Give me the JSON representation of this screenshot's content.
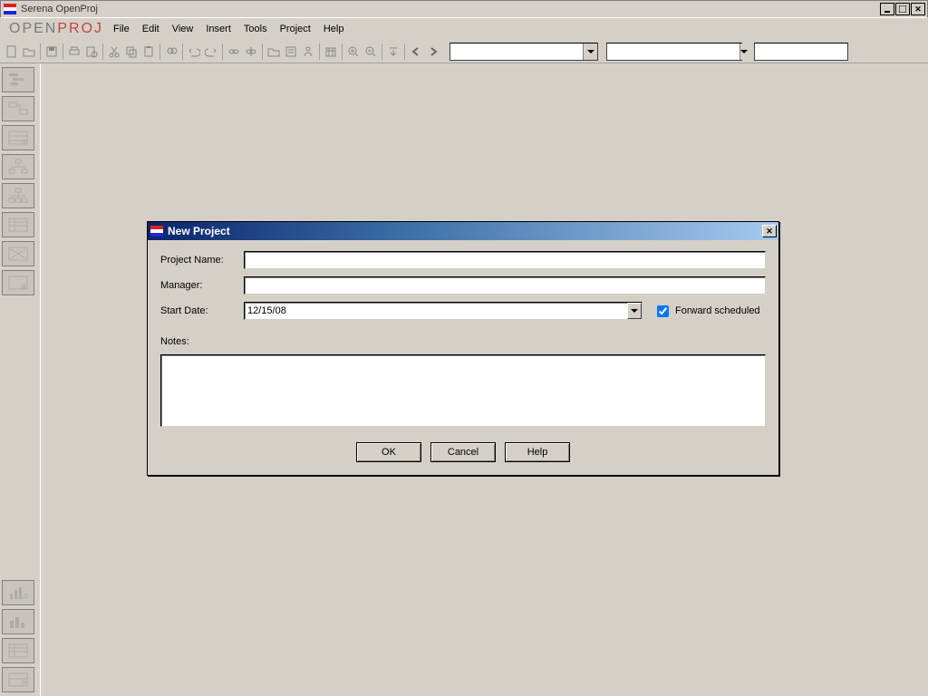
{
  "window": {
    "title": "Serena OpenProj"
  },
  "logo": {
    "open": "OPEN",
    "proj": "PROJ"
  },
  "menu": {
    "file": "File",
    "edit": "Edit",
    "view": "View",
    "insert": "Insert",
    "tools": "Tools",
    "project": "Project",
    "help": "Help"
  },
  "dialog": {
    "title": "New Project",
    "labels": {
      "project_name": "Project Name:",
      "manager": "Manager:",
      "start_date": "Start Date:",
      "notes": "Notes:",
      "forward_scheduled": "Forward scheduled"
    },
    "values": {
      "project_name": "",
      "manager": "",
      "start_date": "12/15/08",
      "forward_scheduled": true,
      "notes": ""
    },
    "buttons": {
      "ok": "OK",
      "cancel": "Cancel",
      "help": "Help"
    }
  }
}
